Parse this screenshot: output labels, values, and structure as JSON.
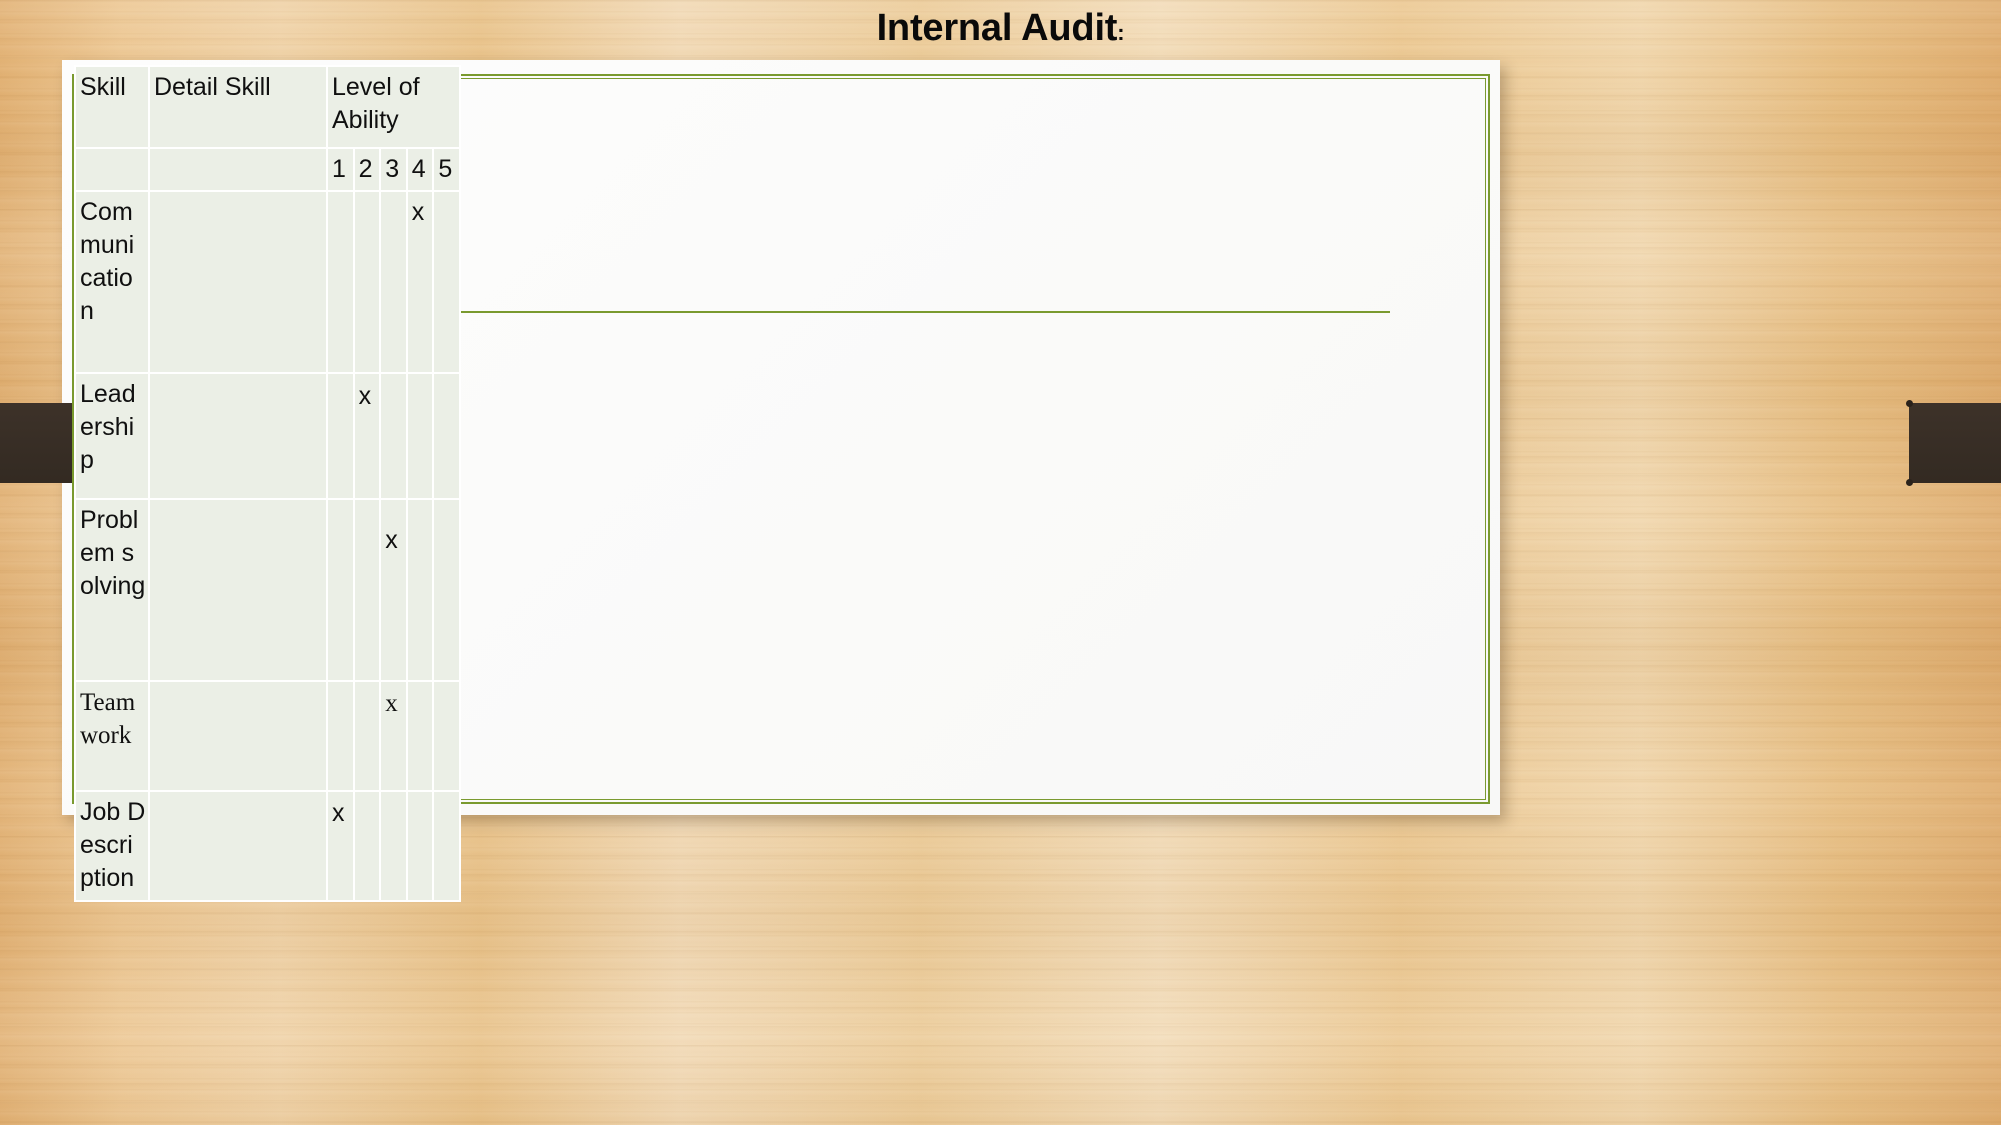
{
  "slide": {
    "title": "Internal Audit",
    "title_colon": ":",
    "accent_green": "#7a9a2f",
    "background_tan": "#edc792",
    "tab_dark": "#3b3129",
    "cell_bg": "#ebefe6"
  },
  "table": {
    "headers": {
      "skill": "Skill",
      "detail_skill": "Detail Skill",
      "level_of_ability": "Level of Ability"
    },
    "levels": [
      "1",
      "2",
      "3",
      "4",
      "5"
    ],
    "mark": "x",
    "rows": [
      {
        "skill": "Communication",
        "detail_skill": "",
        "level": 4
      },
      {
        "skill": "Leadership",
        "detail_skill": "",
        "level": 2
      },
      {
        "skill": "Problem solving",
        "detail_skill": "",
        "level": 3
      },
      {
        "skill": "Teamwork",
        "detail_skill": "",
        "level": 3
      },
      {
        "skill": "Job Description",
        "detail_skill": "",
        "level": 1
      }
    ]
  }
}
